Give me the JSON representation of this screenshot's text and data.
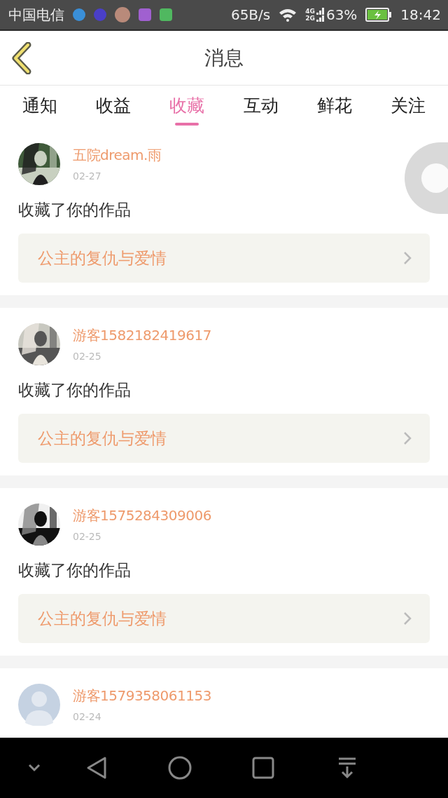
{
  "status_bar": {
    "carrier": "中国电信",
    "speed": "65B/s",
    "network_top": "4G",
    "network_bottom": "2G",
    "battery": "63%",
    "time": "18:42"
  },
  "header": {
    "title": "消息"
  },
  "tabs": [
    {
      "label": "通知",
      "selected": false
    },
    {
      "label": "收益",
      "selected": false
    },
    {
      "label": "收藏",
      "selected": true
    },
    {
      "label": "互动",
      "selected": false
    },
    {
      "label": "鲜花",
      "selected": false
    },
    {
      "label": "关注",
      "selected": false
    }
  ],
  "messages": [
    {
      "name": "五院dream.雨",
      "date": "02-27",
      "action": "收藏了你的作品",
      "work": "公主的复仇与爱情"
    },
    {
      "name": "游客1582182419617",
      "date": "02-25",
      "action": "收藏了你的作品",
      "work": "公主的复仇与爱情"
    },
    {
      "name": "游客1575284309006",
      "date": "02-25",
      "action": "收藏了你的作品",
      "work": "公主的复仇与爱情"
    },
    {
      "name": "游客1579358061153",
      "date": "02-24",
      "avatar": {
        "kind": "default"
      }
    }
  ]
}
